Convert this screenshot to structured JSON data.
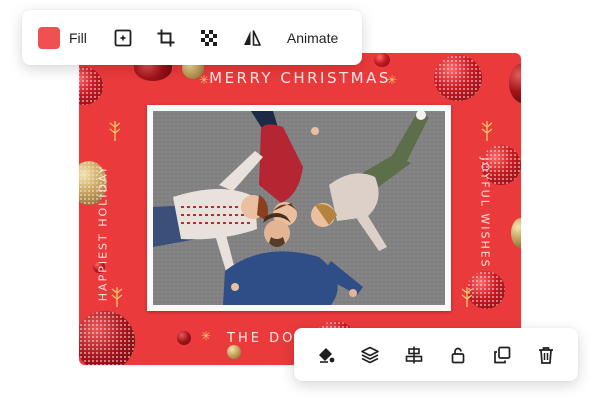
{
  "card": {
    "headline": "MERRY CHRISTMAS",
    "left_vertical_text": "HAPPIEST HOLIDAY",
    "right_vertical_text": "JOYFUL WISHES",
    "bottom_text": "THE DOWA",
    "background_color": "#ea3a3c"
  },
  "top_toolbar": {
    "fill_label": "Fill",
    "fill_color": "#f0504f",
    "icons": [
      "image-adjust-icon",
      "crop-icon",
      "transparency-icon",
      "flip-icon"
    ],
    "animate_label": "Animate"
  },
  "bottom_toolbar": {
    "icons": [
      "fill-color-icon",
      "layers-icon",
      "align-icon",
      "lock-icon",
      "duplicate-icon",
      "delete-icon"
    ]
  }
}
